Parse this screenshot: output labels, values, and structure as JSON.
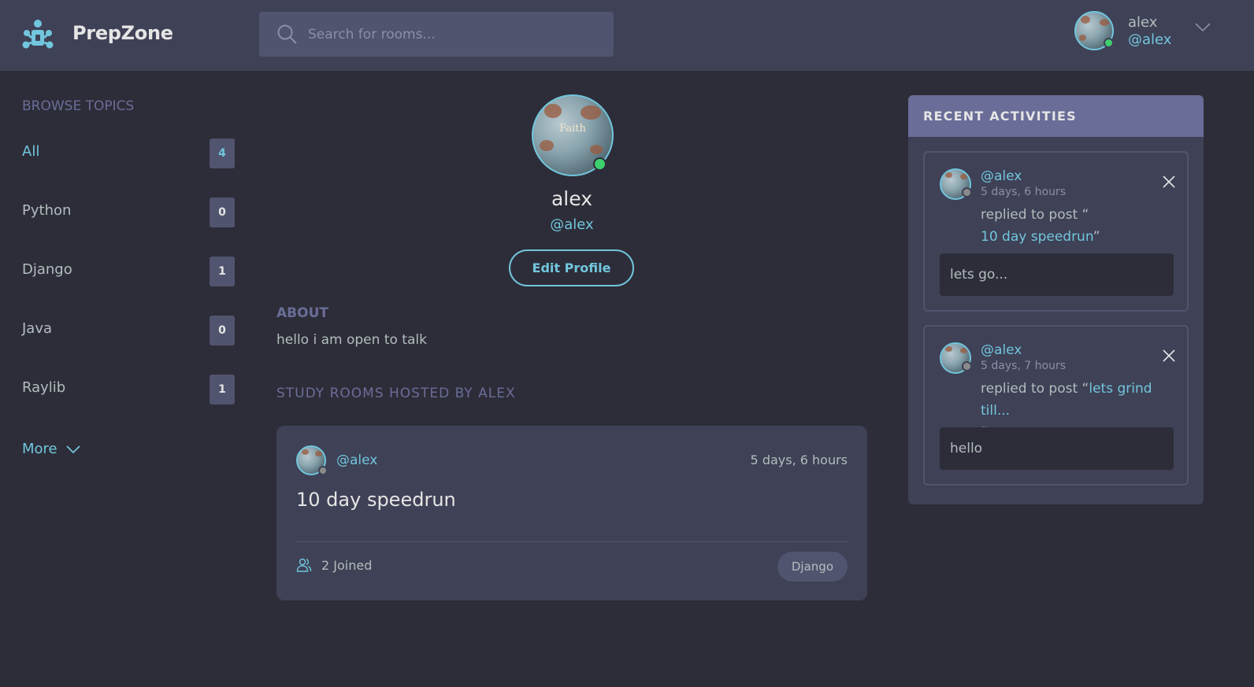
{
  "app": {
    "name": "PrepZone"
  },
  "search": {
    "placeholder": "Search for rooms..."
  },
  "user": {
    "name": "alex",
    "handle": "@alex"
  },
  "sidebar": {
    "title": "BROWSE TOPICS",
    "topics": [
      {
        "label": "All",
        "count": "4",
        "active": true
      },
      {
        "label": "Python",
        "count": "0"
      },
      {
        "label": "Django",
        "count": "1"
      },
      {
        "label": "Java",
        "count": "0"
      },
      {
        "label": "Raylib",
        "count": "1"
      }
    ],
    "more_label": "More"
  },
  "profile": {
    "name": "alex",
    "handle": "@alex",
    "edit_label": "Edit Profile",
    "about_title": "ABOUT",
    "about_text": "hello i am open to talk",
    "rooms_title": "STUDY ROOMS HOSTED BY ALEX",
    "rooms": [
      {
        "host": "@alex",
        "time": "5 days, 6 hours",
        "title": "10 day speedrun",
        "joined": "2 Joined",
        "topic": "Django"
      }
    ]
  },
  "activities": {
    "title": "RECENT ACTIVITIES",
    "items": [
      {
        "handle": "@alex",
        "time": "5 days, 6 hours",
        "prefix": "replied to post “",
        "post": "10 day speedrun",
        "suffix": "”",
        "reply": "lets go..."
      },
      {
        "handle": "@alex",
        "time": "5 days, 7 hours",
        "prefix": "replied to post “",
        "post": "lets grind till...",
        "suffix": "”",
        "reply": "hello"
      }
    ]
  },
  "avatar_text": "Faith",
  "colors": {
    "accent": "#71c6dd",
    "header_bg": "#3f4156",
    "page_bg": "#2d2d39",
    "muted": "#696d97",
    "online": "#3ecf6e"
  }
}
